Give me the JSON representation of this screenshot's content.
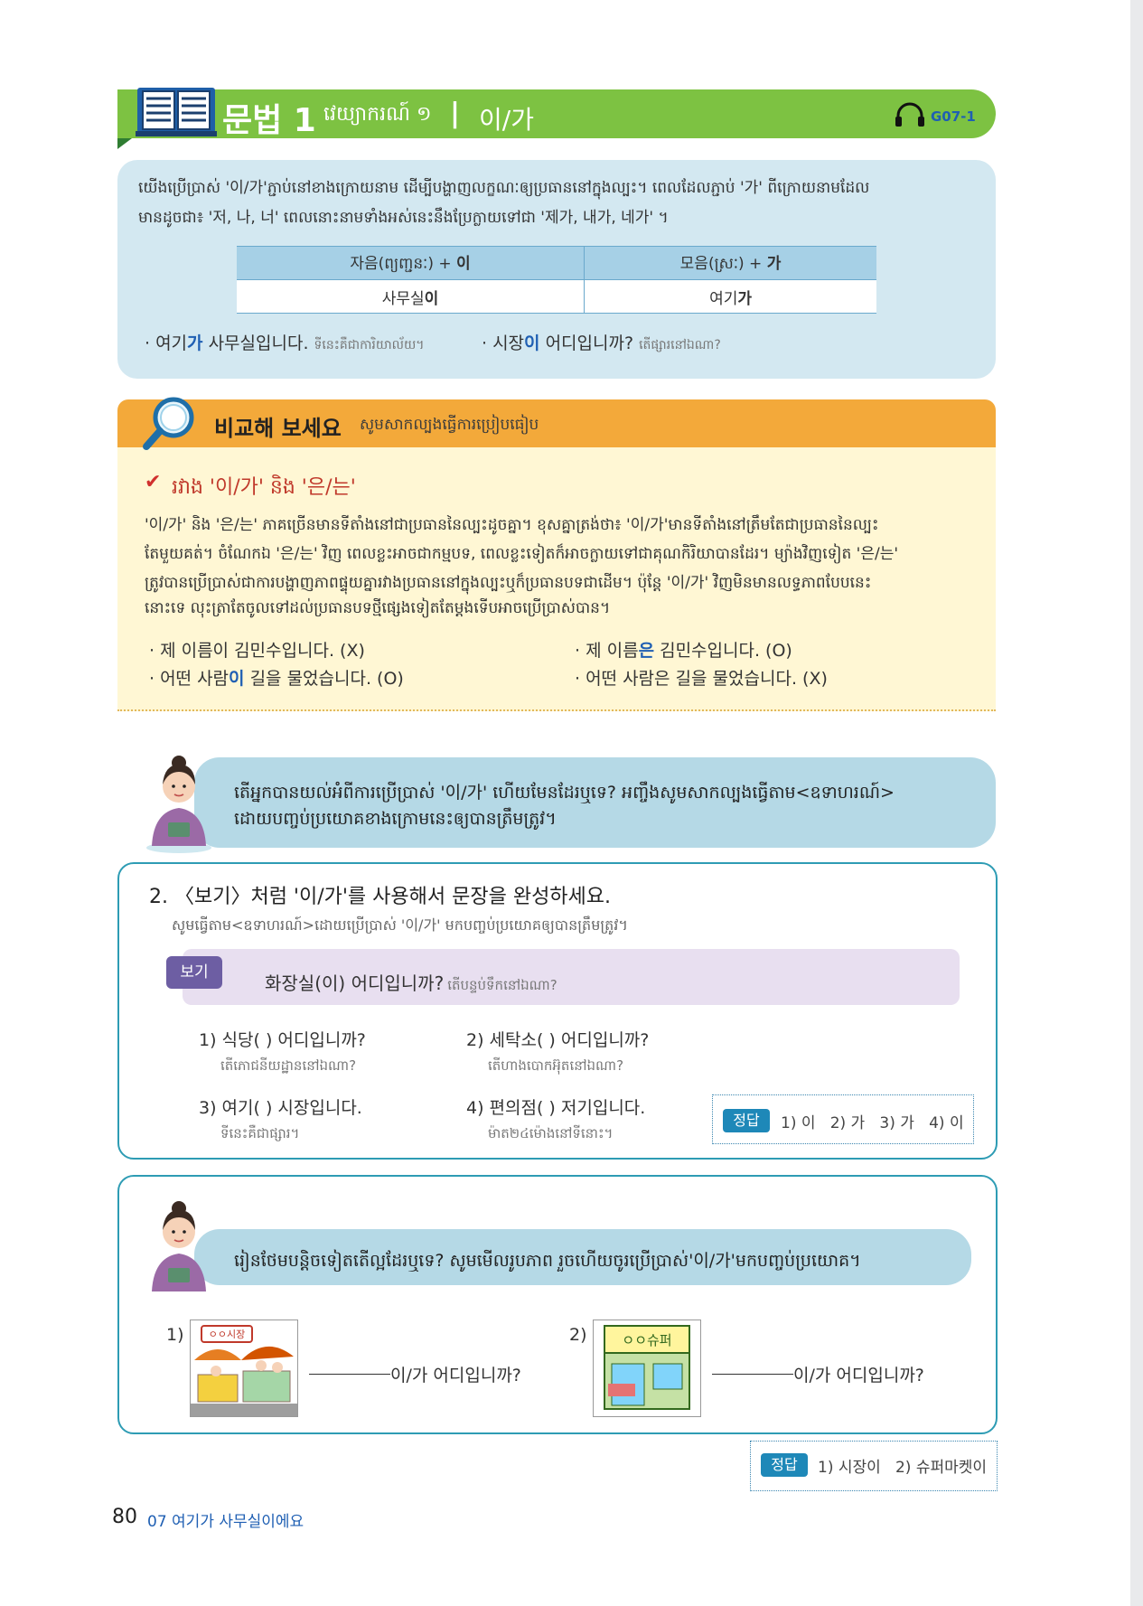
{
  "header": {
    "title": "문법 1",
    "khmer": "វេយ្យាករណ៍ ១",
    "separator": "|",
    "rule": "이/가",
    "audio_code": "G07-1"
  },
  "grammar": {
    "para_line1": "យើងប្រើប្រាស់ '이/가'ភ្ជាប់នៅខាងក្រោយនាម ដើម្បីបង្ហាញលក្ខណៈឲ្យប្រធាននៅក្នុងល្បះ។ ពេលដែលភ្ជាប់ '가' ពីក្រោយនាមដែល",
    "para_line2": "មានដូចជា៖ '저, 나, 너' ពេលនោះនាមទាំងអស់នេះនឹងប្រែក្លាយទៅជា '제가, 내가, 네가' ។",
    "table": {
      "headers": [
        {
          "text": "자음(ព្យញ្ជនៈ) + ",
          "bold": "이"
        },
        {
          "text": "모음(ស្រៈ) + ",
          "bold": "가"
        }
      ],
      "cells": [
        {
          "text": "사무실",
          "bold": "이"
        },
        {
          "text": "여기",
          "bold": "가"
        }
      ]
    },
    "examples": [
      {
        "pre": "· 여기",
        "particle": "가",
        "post": " 사무실입니다.",
        "khmer": "ទីនេះគឺជាការិយាល័យ។"
      },
      {
        "pre": "· 시장",
        "particle": "이",
        "post": " 어디입니까?",
        "khmer": "តើផ្សារនៅឯណា?"
      }
    ]
  },
  "compare": {
    "title": "비교해 보세요",
    "khmer": "សូមសាកល្បងធ្វើការប្រៀបធៀប",
    "subtitle": "រវាង '이/가' និង '은/는'",
    "para": [
      "'이/가' និង '은/는' ភាគច្រើនមានទីតាំងនៅជាប្រធាននៃល្បះដូចគ្នា។ ខុសគ្នាត្រង់ថា៖ '이/가'មានទីតាំងនៅត្រឹមតែជាប្រធាននៃល្បះ",
      "តែមួយគត់។ ចំណែកឯ '은/는' វិញ ពេលខ្លះអាចជាកម្មបទ, ពេលខ្លះទៀតក៏អាចក្លាយទៅជាគុណកិរិយាបានដែរ។ ម្យ៉ាងវិញទៀត '은/는'",
      "ត្រូវបានប្រើប្រាស់ជាការបង្ហាញភាពផ្ទុយគ្នារវាងប្រធាននៅក្នុងល្បះឬក៏ប្រធានបទជាដើម។ ប៉ុន្តែ '이/가' វិញមិនមានលទ្ធភាពបែបនេះ",
      "នោះទេ លុះត្រាតែចូលទៅដល់ប្រធានបទថ្មីផ្សេងទៀតតែម្តងទើបអាចប្រើប្រាស់បាន។"
    ],
    "examples": [
      {
        "pre": "· 제 이름이 김민수입니다. (X)",
        "particle": "",
        "post": ""
      },
      {
        "pre": "· 제 이름",
        "particle": "은",
        "post": " 김민수입니다. (O)"
      },
      {
        "pre": "· 어떤 사람",
        "particle": "이",
        "post": " 길을 물었습니다. (O)"
      },
      {
        "pre": "· 어떤 사람은 길을 물었습니다. (X)",
        "particle": "",
        "post": ""
      }
    ]
  },
  "check": {
    "line1": "តើអ្នកបានយល់អំពីការប្រើប្រាស់ '이/가' ហើយមែនដែរឬទេ? អញ្ចឹងសូមសាកល្បងធ្វើតាម<ឧទាហរណ៍>",
    "line2": "ដោយបញ្ចប់ប្រយោគខាងក្រោមនេះឲ្យបានត្រឹមត្រូវ។"
  },
  "exercise": {
    "title": "2. 〈보기〉처럼 '이/가'를 사용해서 문장을 완성하세요.",
    "title_khmer": "សូមធ្វើតាម<ឧទាហរណ៍>ដោយប្រើប្រាស់ '이/가' មកបញ្ចប់ប្រយោគឲ្យបានត្រឹមត្រូវ។",
    "bogi_label": "보기",
    "bogi_text": "화장실(이) 어디입니까?",
    "bogi_khmer": "តើបន្ទប់ទឹកនៅឯណា?",
    "questions": [
      {
        "ko": "1) 식당(       ) 어디입니까?",
        "km": "តើភោជនីយដ្ឋាននៅឯណា?"
      },
      {
        "ko": "2) 세탁소(       ) 어디입니까?",
        "km": "តើហាងបោកអ៊ុតនៅឯណា?"
      },
      {
        "ko": "3) 여기(       ) 시장입니다.",
        "km": "ទីនេះគឺជាផ្សារ។"
      },
      {
        "ko": "4) 편의점(       ) 저기입니다.",
        "km": "ម៉ាត២៤ម៉ោងនៅទីនោះ។"
      }
    ],
    "answer_label": "정답",
    "answer": "1) 이   2) 가   3) 가   4) 이"
  },
  "more": {
    "text": "រៀនថែមបន្តិចទៀតតើល្អដែរឬទេ? សូមមើលរូបភាព រួចហើយចូរប្រើប្រាស់'이/가'មកបញ្ចប់ប្រយោគ។",
    "items": [
      {
        "num": "1)",
        "sign": "ㅇㅇ시장",
        "suffix": "이/가 어디입니까?"
      },
      {
        "num": "2)",
        "sign": "ㅇㅇ슈퍼",
        "suffix": "이/가 어디입니까?"
      }
    ],
    "answer_label": "정답",
    "answer": "1) 시장이   2) 슈퍼마켓이"
  },
  "footer": {
    "page": "80",
    "chapter": "07 여기가 사무실이에요"
  }
}
